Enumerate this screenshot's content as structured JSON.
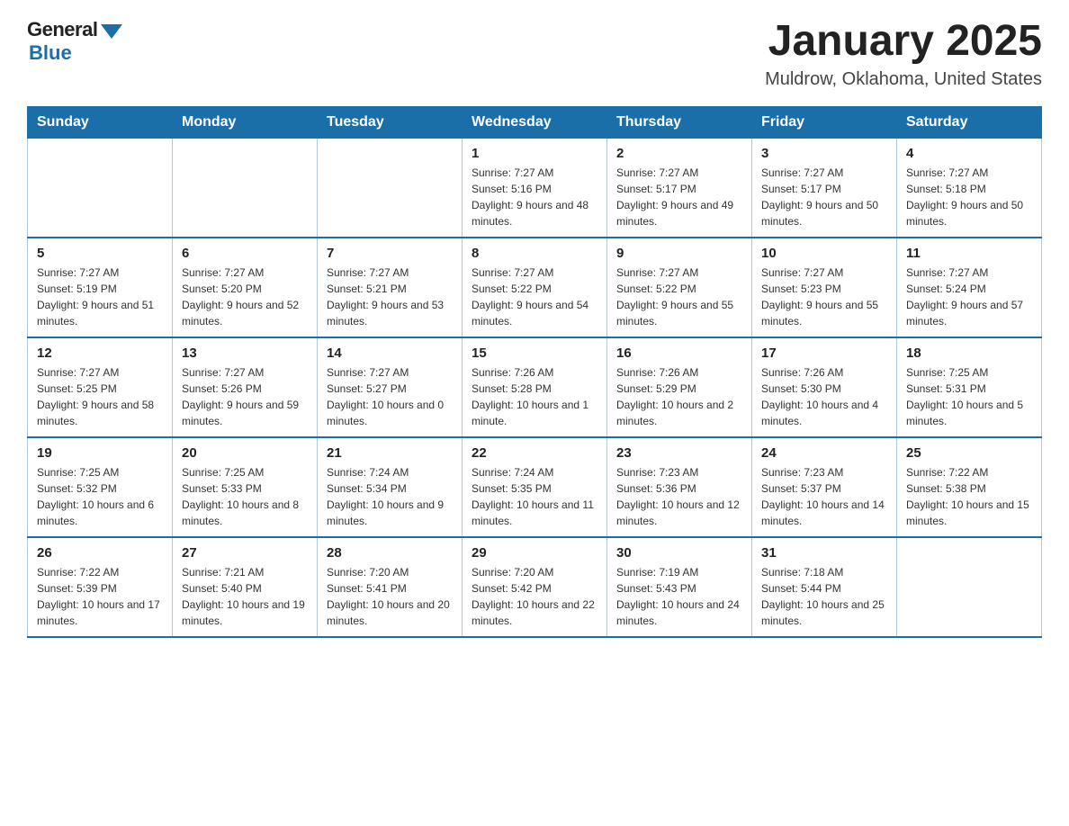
{
  "logo": {
    "general": "General",
    "blue": "Blue"
  },
  "header": {
    "title": "January 2025",
    "location": "Muldrow, Oklahoma, United States"
  },
  "days_of_week": [
    "Sunday",
    "Monday",
    "Tuesday",
    "Wednesday",
    "Thursday",
    "Friday",
    "Saturday"
  ],
  "weeks": [
    [
      {
        "day": "",
        "info": ""
      },
      {
        "day": "",
        "info": ""
      },
      {
        "day": "",
        "info": ""
      },
      {
        "day": "1",
        "info": "Sunrise: 7:27 AM\nSunset: 5:16 PM\nDaylight: 9 hours and 48 minutes."
      },
      {
        "day": "2",
        "info": "Sunrise: 7:27 AM\nSunset: 5:17 PM\nDaylight: 9 hours and 49 minutes."
      },
      {
        "day": "3",
        "info": "Sunrise: 7:27 AM\nSunset: 5:17 PM\nDaylight: 9 hours and 50 minutes."
      },
      {
        "day": "4",
        "info": "Sunrise: 7:27 AM\nSunset: 5:18 PM\nDaylight: 9 hours and 50 minutes."
      }
    ],
    [
      {
        "day": "5",
        "info": "Sunrise: 7:27 AM\nSunset: 5:19 PM\nDaylight: 9 hours and 51 minutes."
      },
      {
        "day": "6",
        "info": "Sunrise: 7:27 AM\nSunset: 5:20 PM\nDaylight: 9 hours and 52 minutes."
      },
      {
        "day": "7",
        "info": "Sunrise: 7:27 AM\nSunset: 5:21 PM\nDaylight: 9 hours and 53 minutes."
      },
      {
        "day": "8",
        "info": "Sunrise: 7:27 AM\nSunset: 5:22 PM\nDaylight: 9 hours and 54 minutes."
      },
      {
        "day": "9",
        "info": "Sunrise: 7:27 AM\nSunset: 5:22 PM\nDaylight: 9 hours and 55 minutes."
      },
      {
        "day": "10",
        "info": "Sunrise: 7:27 AM\nSunset: 5:23 PM\nDaylight: 9 hours and 55 minutes."
      },
      {
        "day": "11",
        "info": "Sunrise: 7:27 AM\nSunset: 5:24 PM\nDaylight: 9 hours and 57 minutes."
      }
    ],
    [
      {
        "day": "12",
        "info": "Sunrise: 7:27 AM\nSunset: 5:25 PM\nDaylight: 9 hours and 58 minutes."
      },
      {
        "day": "13",
        "info": "Sunrise: 7:27 AM\nSunset: 5:26 PM\nDaylight: 9 hours and 59 minutes."
      },
      {
        "day": "14",
        "info": "Sunrise: 7:27 AM\nSunset: 5:27 PM\nDaylight: 10 hours and 0 minutes."
      },
      {
        "day": "15",
        "info": "Sunrise: 7:26 AM\nSunset: 5:28 PM\nDaylight: 10 hours and 1 minute."
      },
      {
        "day": "16",
        "info": "Sunrise: 7:26 AM\nSunset: 5:29 PM\nDaylight: 10 hours and 2 minutes."
      },
      {
        "day": "17",
        "info": "Sunrise: 7:26 AM\nSunset: 5:30 PM\nDaylight: 10 hours and 4 minutes."
      },
      {
        "day": "18",
        "info": "Sunrise: 7:25 AM\nSunset: 5:31 PM\nDaylight: 10 hours and 5 minutes."
      }
    ],
    [
      {
        "day": "19",
        "info": "Sunrise: 7:25 AM\nSunset: 5:32 PM\nDaylight: 10 hours and 6 minutes."
      },
      {
        "day": "20",
        "info": "Sunrise: 7:25 AM\nSunset: 5:33 PM\nDaylight: 10 hours and 8 minutes."
      },
      {
        "day": "21",
        "info": "Sunrise: 7:24 AM\nSunset: 5:34 PM\nDaylight: 10 hours and 9 minutes."
      },
      {
        "day": "22",
        "info": "Sunrise: 7:24 AM\nSunset: 5:35 PM\nDaylight: 10 hours and 11 minutes."
      },
      {
        "day": "23",
        "info": "Sunrise: 7:23 AM\nSunset: 5:36 PM\nDaylight: 10 hours and 12 minutes."
      },
      {
        "day": "24",
        "info": "Sunrise: 7:23 AM\nSunset: 5:37 PM\nDaylight: 10 hours and 14 minutes."
      },
      {
        "day": "25",
        "info": "Sunrise: 7:22 AM\nSunset: 5:38 PM\nDaylight: 10 hours and 15 minutes."
      }
    ],
    [
      {
        "day": "26",
        "info": "Sunrise: 7:22 AM\nSunset: 5:39 PM\nDaylight: 10 hours and 17 minutes."
      },
      {
        "day": "27",
        "info": "Sunrise: 7:21 AM\nSunset: 5:40 PM\nDaylight: 10 hours and 19 minutes."
      },
      {
        "day": "28",
        "info": "Sunrise: 7:20 AM\nSunset: 5:41 PM\nDaylight: 10 hours and 20 minutes."
      },
      {
        "day": "29",
        "info": "Sunrise: 7:20 AM\nSunset: 5:42 PM\nDaylight: 10 hours and 22 minutes."
      },
      {
        "day": "30",
        "info": "Sunrise: 7:19 AM\nSunset: 5:43 PM\nDaylight: 10 hours and 24 minutes."
      },
      {
        "day": "31",
        "info": "Sunrise: 7:18 AM\nSunset: 5:44 PM\nDaylight: 10 hours and 25 minutes."
      },
      {
        "day": "",
        "info": ""
      }
    ]
  ]
}
